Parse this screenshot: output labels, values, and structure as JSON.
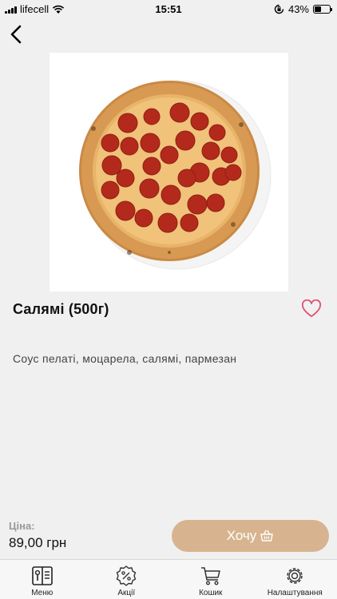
{
  "status_bar": {
    "carrier": "lifecell",
    "time": "15:51",
    "battery": "43%",
    "battery_level": 0.43
  },
  "product": {
    "title": "Салямі (500г)",
    "description": "Соус пелаті, моцарела, салямі, пармезан",
    "price_label": "Ціна:",
    "price": "89,00 грн",
    "image": "pizza-salami-photo"
  },
  "actions": {
    "want_label": "Хочу"
  },
  "colors": {
    "accent": "#d7b48f",
    "heart": "#e0506e",
    "background": "#f0f0f0"
  },
  "tabs": [
    {
      "label": "Меню",
      "icon": "menu-book-icon"
    },
    {
      "label": "Акції",
      "icon": "percent-badge-icon"
    },
    {
      "label": "Кошик",
      "icon": "cart-icon"
    },
    {
      "label": "Налаштування",
      "icon": "gear-icon"
    }
  ]
}
